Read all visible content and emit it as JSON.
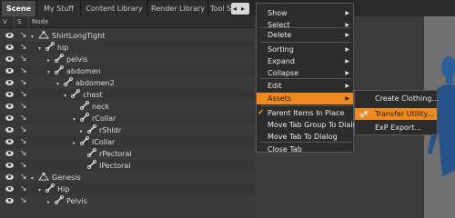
{
  "tabs": [
    {
      "label": "Scene",
      "active": true
    },
    {
      "label": "My Stuff",
      "active": false
    },
    {
      "label": "Content Library",
      "active": false
    },
    {
      "label": "Render Library",
      "active": false
    },
    {
      "label": "Tool S",
      "active": false
    }
  ],
  "tab_arrows": {
    "left": "◂",
    "right": "▸"
  },
  "tree_columns": {
    "visible": "V",
    "selectable": "S",
    "node": "Node"
  },
  "tree_rows": [
    {
      "label": "ShirtLongTight",
      "kind": "figure",
      "expand": "▾"
    },
    {
      "label": "hip",
      "kind": "bone",
      "expand": "▾"
    },
    {
      "label": "pelvis",
      "kind": "bone",
      "expand": "▸"
    },
    {
      "label": "abdomen",
      "kind": "bone",
      "expand": "▾"
    },
    {
      "label": "abdomen2",
      "kind": "bone",
      "expand": "▾"
    },
    {
      "label": "chest",
      "kind": "bone",
      "expand": "▾"
    },
    {
      "label": "neck",
      "kind": "bone",
      "expand": ""
    },
    {
      "label": "rCollar",
      "kind": "bone",
      "expand": "▾"
    },
    {
      "label": "rShldr",
      "kind": "bone",
      "expand": "▸"
    },
    {
      "label": "lCollar",
      "kind": "bone",
      "expand": "▸"
    },
    {
      "label": "rPectoral",
      "kind": "bone",
      "expand": ""
    },
    {
      "label": "lPectoral",
      "kind": "bone",
      "expand": ""
    },
    {
      "label": "Genesis",
      "kind": "figure",
      "expand": "▾"
    },
    {
      "label": "Hip",
      "kind": "bone",
      "expand": "▾"
    },
    {
      "label": "Pelvis",
      "kind": "bone",
      "expand": "▸"
    }
  ],
  "menu": {
    "items": [
      {
        "label": "Show",
        "submenu": true
      },
      {
        "label": "Select",
        "submenu": true
      },
      {
        "label": "Delete",
        "submenu": true
      },
      {
        "label": "Sorting",
        "submenu": true
      },
      {
        "label": "Expand",
        "submenu": true
      },
      {
        "label": "Collapse",
        "submenu": true
      },
      {
        "label": "Edit",
        "submenu": true
      },
      {
        "label": "Assets",
        "submenu": true,
        "highlighted": true
      },
      {
        "label": "Parent Items In Place",
        "checked": true
      },
      {
        "label": "Move Tab Group To Dialog"
      },
      {
        "label": "Move Tab To Dialog"
      },
      {
        "label": "Close Tab"
      }
    ]
  },
  "submenu": {
    "items": [
      {
        "label": "Create Clothing..."
      },
      {
        "label": "Transfer Utility...",
        "highlighted": true
      },
      {
        "label": "ExP Export..."
      }
    ]
  },
  "colors": {
    "accent": "#f08a1c",
    "menu_bg": "#2c2c2c",
    "panel_bg": "#3a3a3a"
  },
  "icons": {
    "visibility": "eye-icon",
    "selectable": "cursor-icon",
    "bone": "bone-icon",
    "figure": "figure-icon",
    "check": "check-icon",
    "utility": "gear-icon"
  }
}
